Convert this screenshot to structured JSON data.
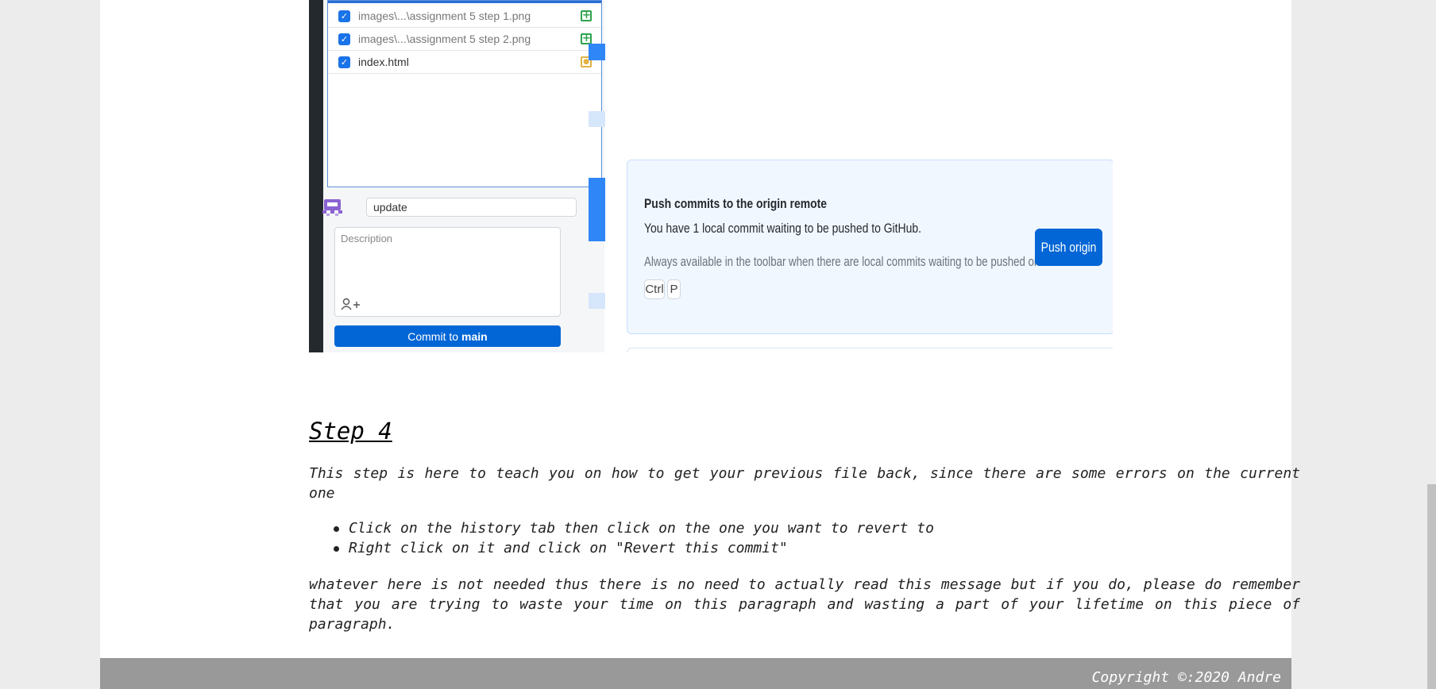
{
  "screenshot": {
    "files": [
      {
        "name": "images\\...\\assignment 5 step 1.png",
        "status": "added"
      },
      {
        "name": "images\\...\\assignment 5 step 2.png",
        "status": "added"
      },
      {
        "name": "index.html",
        "status": "modified"
      }
    ],
    "summary_value": "update",
    "description_placeholder": "Description",
    "commit_prefix": "Commit to",
    "commit_branch": "main",
    "push_card": {
      "title": "Push commits to the origin remote",
      "subtitle": "You have 1 local commit waiting to be pushed to GitHub.",
      "note": "Always available in the toolbar when there are local commits waiting to be pushed or",
      "keys": [
        "Ctrl",
        "P"
      ],
      "button": "Push origin"
    }
  },
  "article": {
    "step_title": "Step 4",
    "intro": "This step is here to teach you on how to get your previous file back, since there are some errors on the current one",
    "bullets": [
      "Click on the history tab then click on the one you want to revert to",
      "Right click on it and click on \"Revert this commit\""
    ],
    "outro": "whatever here is not needed thus there is no need to actually read this message but if you do, please do remember that you are trying to waste your time on this paragraph and wasting a part of your lifetime on this piece of paragraph."
  },
  "footer": {
    "copyright": "Copyright ©:2020 Andre"
  },
  "colors": {
    "accent": "#0366d6",
    "footer_bg": "#999999",
    "page_bg": "#ececec"
  }
}
